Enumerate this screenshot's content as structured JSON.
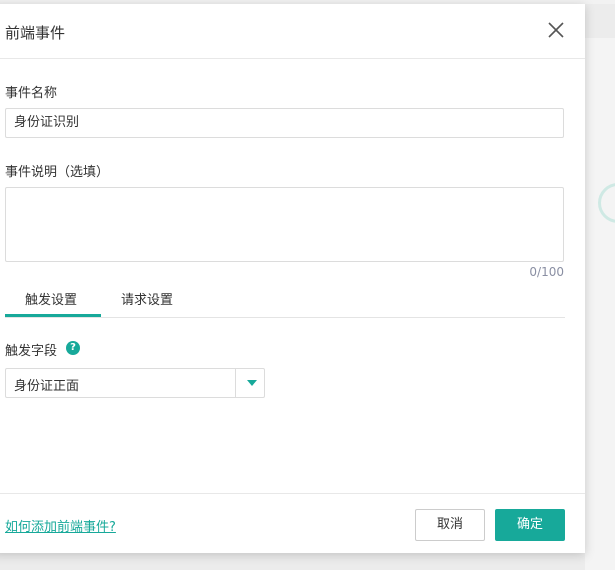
{
  "modal": {
    "title": "前端事件",
    "close_icon": "close-icon"
  },
  "form": {
    "event_name_label": "事件名称",
    "event_name_value": "身份证识别",
    "event_desc_label": "事件说明（选填）",
    "event_desc_value": "",
    "event_desc_counter": "0/100"
  },
  "tabs": [
    {
      "label": "触发设置",
      "active": true
    },
    {
      "label": "请求设置",
      "active": false
    }
  ],
  "trigger": {
    "field_label": "触发字段",
    "help_icon": "question-circle-icon",
    "help_glyph": "?",
    "select_value": "身份证正面"
  },
  "footer": {
    "help_link": "如何添加前端事件?",
    "cancel_label": "取消",
    "ok_label": "确定"
  },
  "colors": {
    "accent": "#17a99a",
    "border": "#dcdcdc",
    "text": "#333333",
    "muted": "#8a8fa3"
  }
}
